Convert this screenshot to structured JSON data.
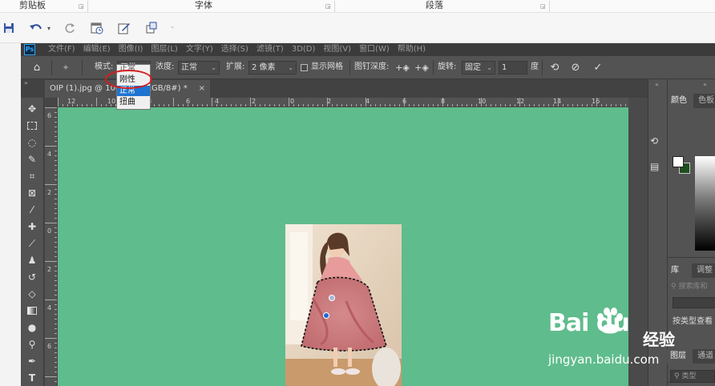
{
  "ribbon": {
    "groups": [
      {
        "label": "剪贴板"
      },
      {
        "label": "字体"
      },
      {
        "label": "段落"
      }
    ]
  },
  "photoshop": {
    "logo": "Ps",
    "menus": [
      "文件(F)",
      "编辑(E)",
      "图像(I)",
      "图层(L)",
      "文字(Y)",
      "选择(S)",
      "滤镜(T)",
      "3D(D)",
      "视图(V)",
      "窗口(W)",
      "帮助(H)"
    ],
    "options": {
      "mode_label": "模式:",
      "mode_value": "正常",
      "density_label": "浓度:",
      "density_value": "正常",
      "expand_label": "扩展:",
      "expand_value": "2 像素",
      "show_mesh_label": "显示网格",
      "pin_depth_label": "图钉深度:",
      "rotate_label": "旋转:",
      "rotate_value": "固定",
      "angle_value": "1",
      "degree_label": "度"
    },
    "mode_dropdown": {
      "items": [
        "正常",
        "刚性",
        "正常",
        "扭曲"
      ],
      "selected_index": 2
    },
    "document_tab": {
      "title": "OIP (1).jpg @ 100",
      "title_suffix": "RGB/8#) *",
      "close": "×"
    },
    "ruler_h_labels": [
      "12",
      "10",
      "8",
      "6",
      "4",
      "2",
      "0",
      "2",
      "4",
      "6",
      "8",
      "10",
      "12",
      "14",
      "16"
    ],
    "ruler_v_labels": [
      "6",
      "4",
      "2",
      "0",
      "2",
      "4",
      "6"
    ],
    "panels": {
      "color_tabs": [
        "颜色",
        "色板"
      ],
      "library_tabs": [
        "库",
        "调整"
      ],
      "library_search_placeholder": "搜索库和",
      "library_view": "按类型查看",
      "layers_tabs": [
        "图层",
        "通道"
      ],
      "layers_filter_placeholder": "类型"
    },
    "colors": {
      "canvas_bg": "#5fbc8d",
      "foreground": "#ffffff",
      "background": "#1f4f1f"
    }
  },
  "watermark": {
    "brand": "Bai du",
    "brand_cn": "经验",
    "url": "jingyan.baidu.com"
  }
}
